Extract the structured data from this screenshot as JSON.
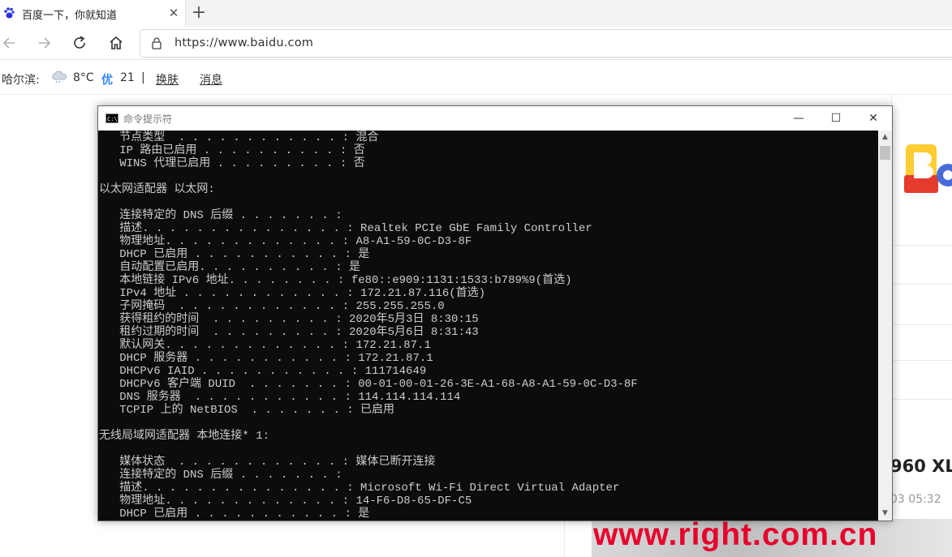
{
  "browser": {
    "tab_title": "百度一下，你就知道",
    "close_glyph": "✕",
    "new_tab_glyph": "+",
    "url": "https://www.baidu.com"
  },
  "infobar": {
    "city": "哈尔滨:",
    "temperature": "8°C",
    "aqi_level": "优",
    "aqi_value": "21",
    "separator": "|",
    "skin_link": "换肤",
    "messages_link": "消息"
  },
  "page": {
    "headline_fragment": "960 XL",
    "time_fragment": "03 05:32",
    "watermark": "www.right.com.cn"
  },
  "cmd": {
    "title": "命令提示符",
    "minimize_glyph": "—",
    "maximize_glyph": "☐",
    "close_glyph": "✕",
    "scroll_up_glyph": "▲",
    "scroll_down_glyph": "▼",
    "lines": [
      "   节点类型  . . . . . . . . . . . . : 混合",
      "   IP 路由已启用 . . . . . . . . . . : 否",
      "   WINS 代理已启用 . . . . . . . . . : 否",
      "",
      "以太网适配器 以太网:",
      "",
      "   连接特定的 DNS 后缀 . . . . . . . :",
      "   描述. . . . . . . . . . . . . . . : Realtek PCIe GbE Family Controller",
      "   物理地址. . . . . . . . . . . . . : A8-A1-59-0C-D3-8F",
      "   DHCP 已启用 . . . . . . . . . . . : 是",
      "   自动配置已启用. . . . . . . . . . : 是",
      "   本地链接 IPv6 地址. . . . . . . . : fe80::e909:1131:1533:b789%9(首选)",
      "   IPv4 地址 . . . . . . . . . . . . : 172.21.87.116(首选)",
      "   子网掩码  . . . . . . . . . . . . : 255.255.255.0",
      "   获得租约的时间  . . . . . . . . . : 2020年5月3日 8:30:15",
      "   租约过期的时间  . . . . . . . . . : 2020年5月6日 8:31:43",
      "   默认网关. . . . . . . . . . . . . : 172.21.87.1",
      "   DHCP 服务器 . . . . . . . . . . . : 172.21.87.1",
      "   DHCPv6 IAID . . . . . . . . . . . : 111714649",
      "   DHCPv6 客户端 DUID  . . . . . . . : 00-01-00-01-26-3E-A1-68-A8-A1-59-0C-D3-8F",
      "   DNS 服务器  . . . . . . . . . . . : 114.114.114.114",
      "   TCPIP 上的 NetBIOS  . . . . . . . : 已启用",
      "",
      "无线局域网适配器 本地连接* 1:",
      "",
      "   媒体状态  . . . . . . . . . . . . : 媒体已断开连接",
      "   连接特定的 DNS 后缀 . . . . . . . :",
      "   描述. . . . . . . . . . . . . . . : Microsoft Wi-Fi Direct Virtual Adapter",
      "   物理地址. . . . . . . . . . . . . : 14-F6-D8-65-DF-C5",
      "   DHCP 已启用 . . . . . . . . . . . : 是"
    ]
  },
  "icons": {
    "tab_favicon": "paw-icon",
    "back": "arrow-left-icon",
    "forward": "arrow-right-icon",
    "refresh": "refresh-icon",
    "home": "home-icon",
    "lock": "lock-icon",
    "weather": "cloud-rain-icon",
    "cmd": "console-icon"
  },
  "colors": {
    "console_bg": "#0c0c0c",
    "console_text": "#cccccc",
    "watermark": "#e8002d",
    "aqi_good": "#3385ff"
  }
}
